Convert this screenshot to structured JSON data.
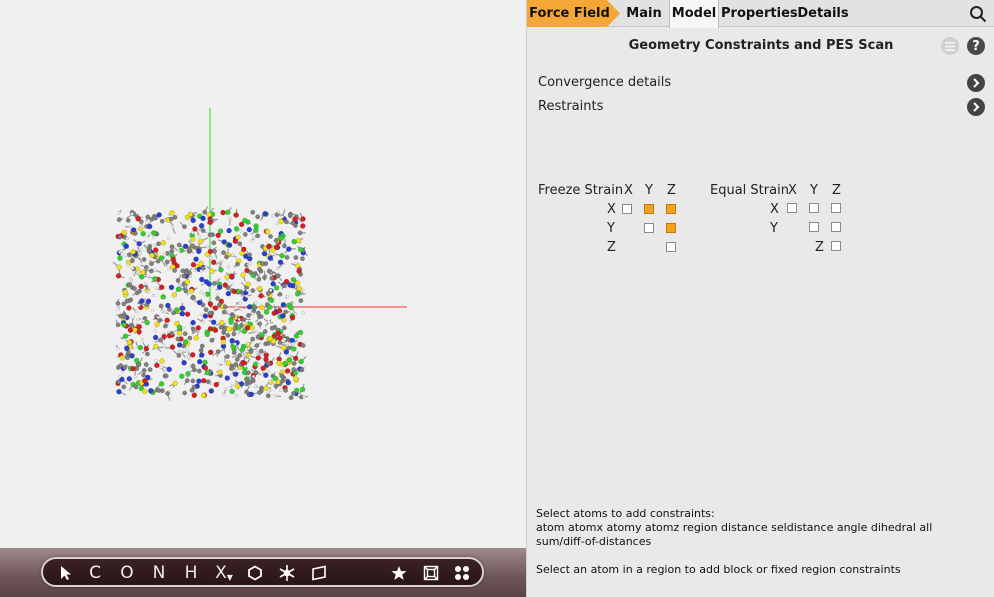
{
  "tabs": [
    {
      "label": "Force Field"
    },
    {
      "label": "Main"
    },
    {
      "label": "Model"
    },
    {
      "label": "Properties"
    },
    {
      "label": "Details"
    }
  ],
  "panel": {
    "title": "Geometry Constraints and PES Scan",
    "menu_icon": "menu-icon",
    "help_label": "?",
    "rows": [
      {
        "label": "Convergence details"
      },
      {
        "label": "Restraints"
      }
    ],
    "freeze": {
      "label": "Freeze Strain",
      "cols": [
        "X",
        "Y",
        "Z"
      ],
      "rows": [
        "X",
        "Y",
        "Z"
      ],
      "checked": {
        "xx": false,
        "xy": true,
        "xz": true,
        "yy": false,
        "yz": true,
        "zz": false
      }
    },
    "equal": {
      "label": "Equal Strain",
      "cols": [
        "X",
        "Y",
        "Z"
      ],
      "rows": [
        "X",
        "Y",
        "Z"
      ],
      "checked": {
        "xx": false,
        "xy": false,
        "xz": false,
        "yy": false,
        "yz": false,
        "zz": false
      }
    },
    "help_text": {
      "line1": "Select atoms to add constraints:",
      "line2": "atom atomx atomy atomz region distance seldistance angle dihedral all",
      "line3": "sum/diff-of-distances",
      "line4": "Select an atom in a region to add block or fixed region constraints"
    }
  },
  "toolbar": {
    "items": [
      {
        "name": "select-arrow-icon"
      },
      {
        "label": "C"
      },
      {
        "label": "O"
      },
      {
        "label": "N"
      },
      {
        "label": "H"
      },
      {
        "label": "X"
      },
      {
        "name": "ring-icon"
      },
      {
        "name": "freeze-icon"
      },
      {
        "name": "plane-icon"
      },
      {
        "name": "star-icon"
      },
      {
        "name": "cell-box-icon"
      },
      {
        "name": "dots-icon"
      }
    ]
  },
  "colors": {
    "accent": "#f4a637",
    "checked": "#f4a41c",
    "carbon": "#808080",
    "oxygen": "#d42020",
    "nitrogen": "#2a3fd0",
    "sulfur": "#f0e020",
    "chlorine": "#30d030",
    "hydrogen": "#f4f4f4"
  }
}
